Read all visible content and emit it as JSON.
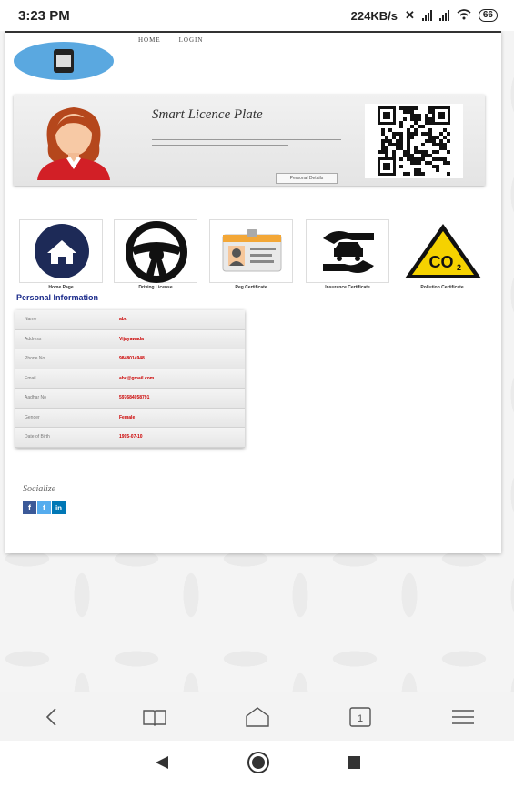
{
  "status_bar": {
    "time": "3:23 PM",
    "network_speed": "224KB/s",
    "battery": "66"
  },
  "nav": {
    "home": "HOME",
    "login": "LOGIN"
  },
  "hero": {
    "title": "Smart Licence Plate",
    "button_label": "Personal Details"
  },
  "cards": [
    {
      "label": "Home Page",
      "icon": "house-icon"
    },
    {
      "label": "Driving License",
      "icon": "steering-wheel-icon"
    },
    {
      "label": "Reg Certificate",
      "icon": "id-card-icon"
    },
    {
      "label": "Insurance Certificate",
      "icon": "car-insurance-icon"
    },
    {
      "label": "Pollution Certificate",
      "icon": "co2-warning-icon"
    }
  ],
  "personal_info": {
    "title": "Personal Information",
    "rows": [
      {
        "key": "Name",
        "value": "abc"
      },
      {
        "key": "Address",
        "value": "Vijayawada"
      },
      {
        "key": "Phone No",
        "value": "9848014948"
      },
      {
        "key": "Email",
        "value": "abc@gmail.com"
      },
      {
        "key": "Aadhar No",
        "value": "597684058791"
      },
      {
        "key": "Gender",
        "value": "Female"
      },
      {
        "key": "Date of Birth",
        "value": "1995-07-10"
      }
    ]
  },
  "social": {
    "title": "Socialize",
    "facebook": "f",
    "twitter": "t",
    "linkedin": "in"
  },
  "colors": {
    "accent_blue": "#1a2a8a",
    "value_red": "#c00000",
    "facebook": "#3b5998",
    "twitter": "#55acee",
    "linkedin": "#0077b5"
  }
}
